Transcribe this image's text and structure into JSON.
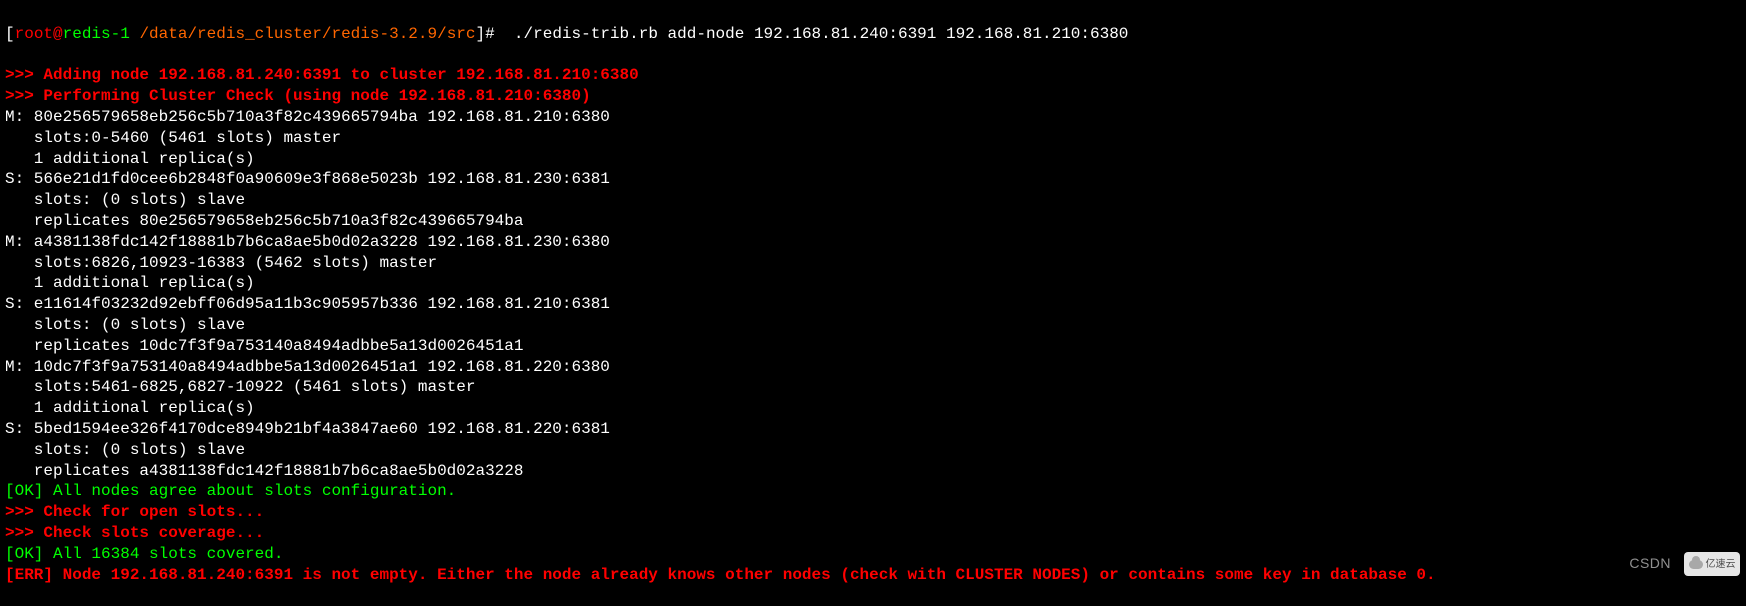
{
  "prompt": {
    "open_bracket": "[",
    "user": "root",
    "at": "@",
    "host": "redis-1",
    "path": " /data/redis_cluster/redis-3.2.9/src",
    "close_bracket": "]#  ",
    "command": "./redis-trib.rb add-node 192.168.81.240:6391 192.168.81.210:6380"
  },
  "lines": [
    {
      "cls": "red-msg",
      "text": ">>> Adding node 192.168.81.240:6391 to cluster 192.168.81.210:6380"
    },
    {
      "cls": "red-msg",
      "text": ">>> Performing Cluster Check (using node 192.168.81.210:6380)"
    },
    {
      "cls": "white-msg",
      "text": "M: 80e256579658eb256c5b710a3f82c439665794ba 192.168.81.210:6380"
    },
    {
      "cls": "white-msg",
      "text": "   slots:0-5460 (5461 slots) master"
    },
    {
      "cls": "white-msg",
      "text": "   1 additional replica(s)"
    },
    {
      "cls": "white-msg",
      "text": "S: 566e21d1fd0cee6b2848f0a90609e3f868e5023b 192.168.81.230:6381"
    },
    {
      "cls": "white-msg",
      "text": "   slots: (0 slots) slave"
    },
    {
      "cls": "white-msg",
      "text": "   replicates 80e256579658eb256c5b710a3f82c439665794ba"
    },
    {
      "cls": "white-msg",
      "text": "M: a4381138fdc142f18881b7b6ca8ae5b0d02a3228 192.168.81.230:6380"
    },
    {
      "cls": "white-msg",
      "text": "   slots:6826,10923-16383 (5462 slots) master"
    },
    {
      "cls": "white-msg",
      "text": "   1 additional replica(s)"
    },
    {
      "cls": "white-msg",
      "text": "S: e11614f03232d92ebff06d95a11b3c905957b336 192.168.81.210:6381"
    },
    {
      "cls": "white-msg",
      "text": "   slots: (0 slots) slave"
    },
    {
      "cls": "white-msg",
      "text": "   replicates 10dc7f3f9a753140a8494adbbe5a13d0026451a1"
    },
    {
      "cls": "white-msg",
      "text": "M: 10dc7f3f9a753140a8494adbbe5a13d0026451a1 192.168.81.220:6380"
    },
    {
      "cls": "white-msg",
      "text": "   slots:5461-6825,6827-10922 (5461 slots) master"
    },
    {
      "cls": "white-msg",
      "text": "   1 additional replica(s)"
    },
    {
      "cls": "white-msg",
      "text": "S: 5bed1594ee326f4170dce8949b21bf4a3847ae60 192.168.81.220:6381"
    },
    {
      "cls": "white-msg",
      "text": "   slots: (0 slots) slave"
    },
    {
      "cls": "white-msg",
      "text": "   replicates a4381138fdc142f18881b7b6ca8ae5b0d02a3228"
    },
    {
      "cls": "green-msg",
      "text": "[OK] All nodes agree about slots configuration."
    },
    {
      "cls": "red-msg",
      "text": ">>> Check for open slots..."
    },
    {
      "cls": "red-msg",
      "text": ">>> Check slots coverage..."
    },
    {
      "cls": "green-msg",
      "text": "[OK] All 16384 slots covered."
    },
    {
      "cls": "red-msg",
      "text": "[ERR] Node 192.168.81.240:6391 is not empty. Either the node already knows other nodes (check with CLUSTER NODES) or contains some key in database 0."
    }
  ],
  "watermark": {
    "csdn": "CSDN",
    "logo": "亿速云"
  }
}
